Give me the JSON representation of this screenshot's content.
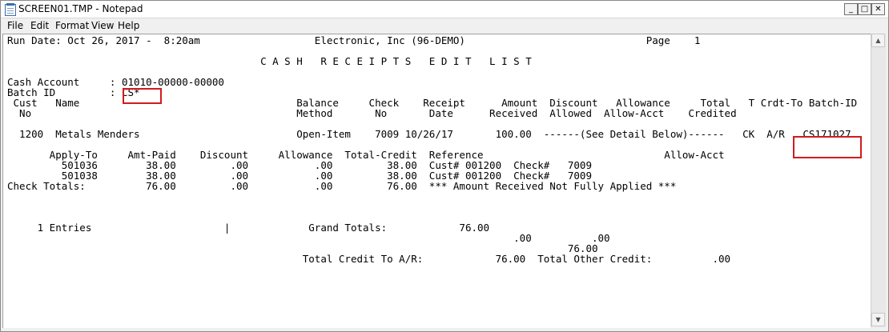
{
  "window": {
    "title": "SCREEN01.TMP - Notepad",
    "minimize_glyph": "_",
    "maximize_glyph": "□",
    "close_glyph": "✕"
  },
  "menu": [
    "File",
    "Edit",
    "Format",
    "View",
    "Help"
  ],
  "document": {
    "lines": [
      "Run Date: Oct 26, 2017 -  8:20am                   Electronic, Inc (96-DEMO)                              Page    1",
      "",
      "                                          C A S H   R E C E I P T S   E D I T   L I S T",
      "",
      "Cash Account     : 01010-00000-00000",
      "Batch ID         : CS*",
      " Cust   Name                                    Balance     Check    Receipt      Amount  Discount   Allowance     Total   T Crdt-To Batch-ID",
      "  No                                            Method       No       Date      Received  Allowed  Allow-Acct    Credited",
      "",
      "  1200  Metals Menders                          Open-Item    7009 10/26/17       100.00  ------(See Detail Below)------   CK  A/R   CS171027",
      "",
      "       Apply-To     Amt-Paid    Discount     Allowance  Total-Credit  Reference                              Allow-Acct",
      "         501036        38.00         .00           .00         38.00  Cust# 001200  Check#   7009",
      "         501038        38.00         .00           .00         38.00  Cust# 001200  Check#   7009",
      "Check Totals:          76.00         .00           .00         76.00  *** Amount Received Not Fully Applied ***",
      "",
      "",
      "",
      "     1 Entries                      |             Grand Totals:            76.00",
      "                                                                                    .00          .00",
      "                                                                                             76.00",
      "                                                 Total Credit To A/R:            76.00  Total Other Credit:          .00"
    ]
  },
  "highlights": {
    "batch_id_value": "CS*",
    "batch_id_column_value": "CS171027"
  },
  "colors": {
    "highlight_border": "#d01c1c",
    "editor_background": "#ffffff",
    "chrome_background": "#f0f0f0"
  },
  "scrollbar": {
    "up_glyph": "▲",
    "down_glyph": "▼"
  }
}
